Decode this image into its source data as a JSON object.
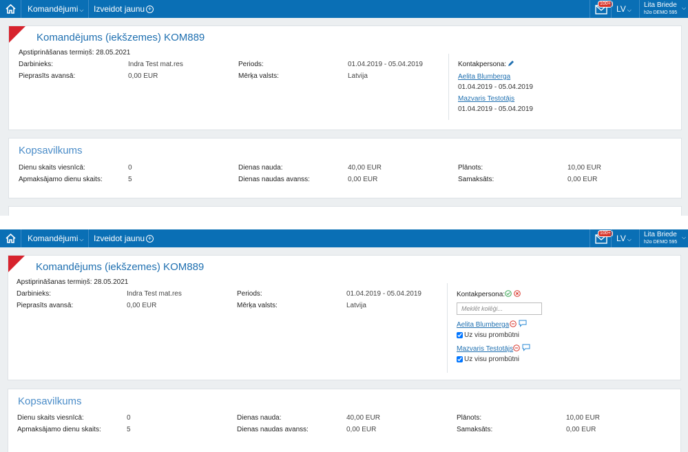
{
  "nav": {
    "menu_trips": "Komandējumi",
    "menu_create": "Izveidot jaunu",
    "badge": "100+",
    "lang": "LV",
    "user_name": "Lita Briede",
    "user_org": "h2o DEMO 595"
  },
  "trip": {
    "title": "Komandējums (iekšzemes) KOM889",
    "approval_label": "Apstiprināšanas termiņš:",
    "approval_value": "28.05.2021",
    "employee_label": "Darbinieks:",
    "employee_value": "Indra Test mat.res",
    "advance_label": "Pieprasīts avansā:",
    "advance_value": "0,00 EUR",
    "period_label": "Periods:",
    "period_value": "01.04.2019 - 05.04.2019",
    "country_label": "Mērķa valsts:",
    "country_value": "Latvija",
    "contact_label": "Kontakpersona:",
    "contacts": [
      {
        "name": "Aelita Blumberga",
        "period": "01.04.2019 - 05.04.2019",
        "checkbox": "Uz visu prombūtni"
      },
      {
        "name": "Mazvaris Testotājs",
        "period": "01.04.2019 - 05.04.2019",
        "checkbox": "Uz visu prombūtni"
      }
    ],
    "search_placeholder": "Meklēt kolēģi..."
  },
  "summary": {
    "title": "Kopsavilkums",
    "hotel_days_label": "Dienu skaits viesnīcā:",
    "hotel_days_value": "0",
    "paid_days_label": "Apmaksājamo dienu skaits:",
    "paid_days_value": "5",
    "allowance_label": "Dienas nauda:",
    "allowance_value": "40,00 EUR",
    "allowance_advance_label": "Dienas naudas avanss:",
    "allowance_advance_value": "0,00 EUR",
    "planned_label": "Plānots:",
    "planned_value": "10,00 EUR",
    "paid_label": "Samaksāts:",
    "paid_value": "0,00 EUR"
  },
  "colors": {
    "nav": "#0a6fb5",
    "title": "#1e6fb0",
    "corner": "#d7232d",
    "ok": "#3aa655",
    "cancel": "#d9352b"
  }
}
